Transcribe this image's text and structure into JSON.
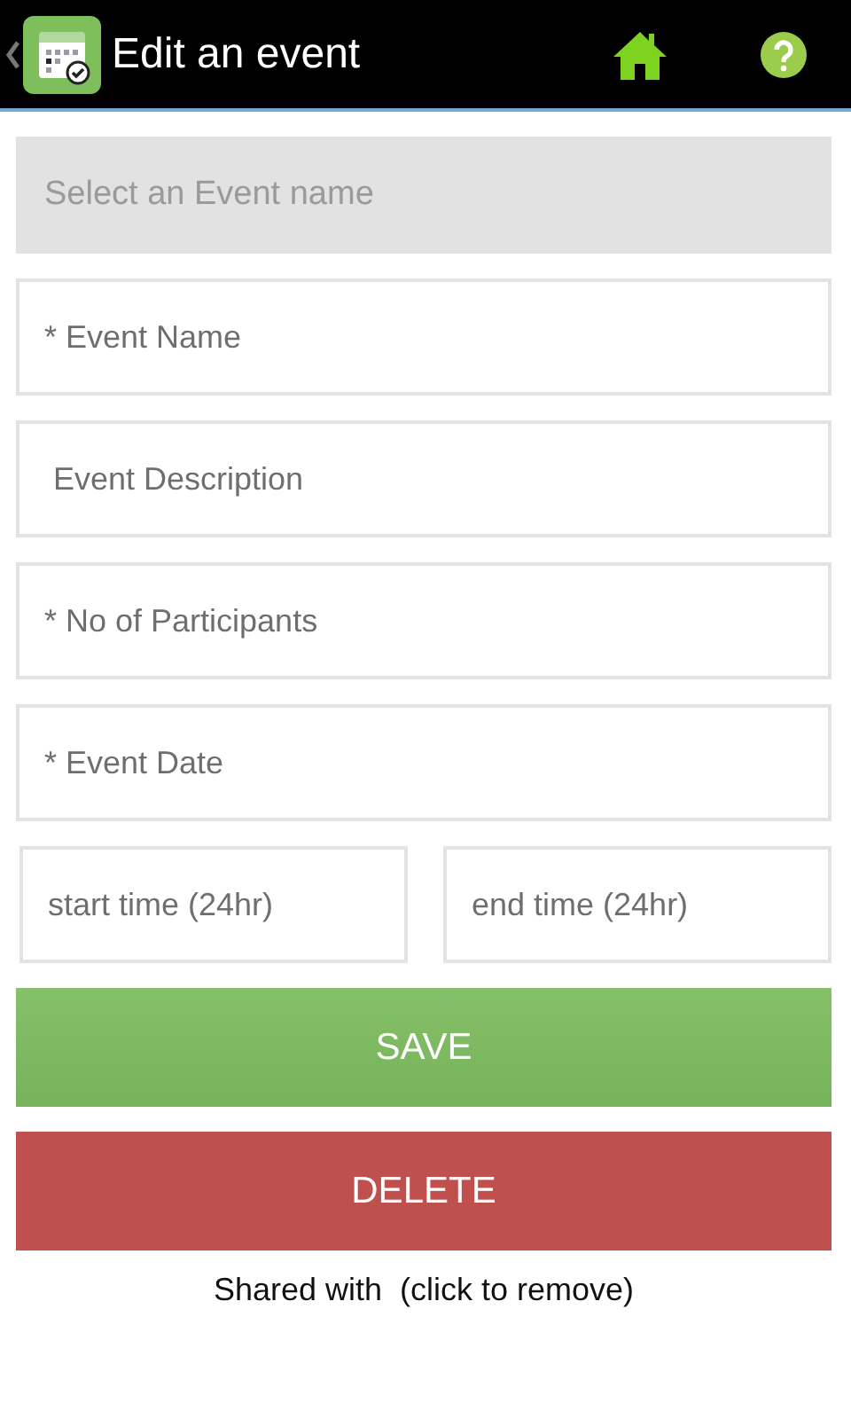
{
  "action_bar": {
    "title": "Edit an event"
  },
  "event_select": {
    "placeholder": "Select an Event name"
  },
  "fields": [
    {
      "placeholder": "* Event Name"
    },
    {
      "placeholder": " Event Description"
    },
    {
      "placeholder": "* No of Participants"
    },
    {
      "placeholder": "* Event Date"
    }
  ],
  "time_fields": [
    {
      "placeholder": "start time (24hr)"
    },
    {
      "placeholder": "end time (24hr)"
    }
  ],
  "buttons": [
    {
      "label": "SAVE",
      "kind": "save"
    },
    {
      "label": "DELETE",
      "kind": "delete"
    }
  ],
  "shared_text": "Shared with  (click to remove)"
}
